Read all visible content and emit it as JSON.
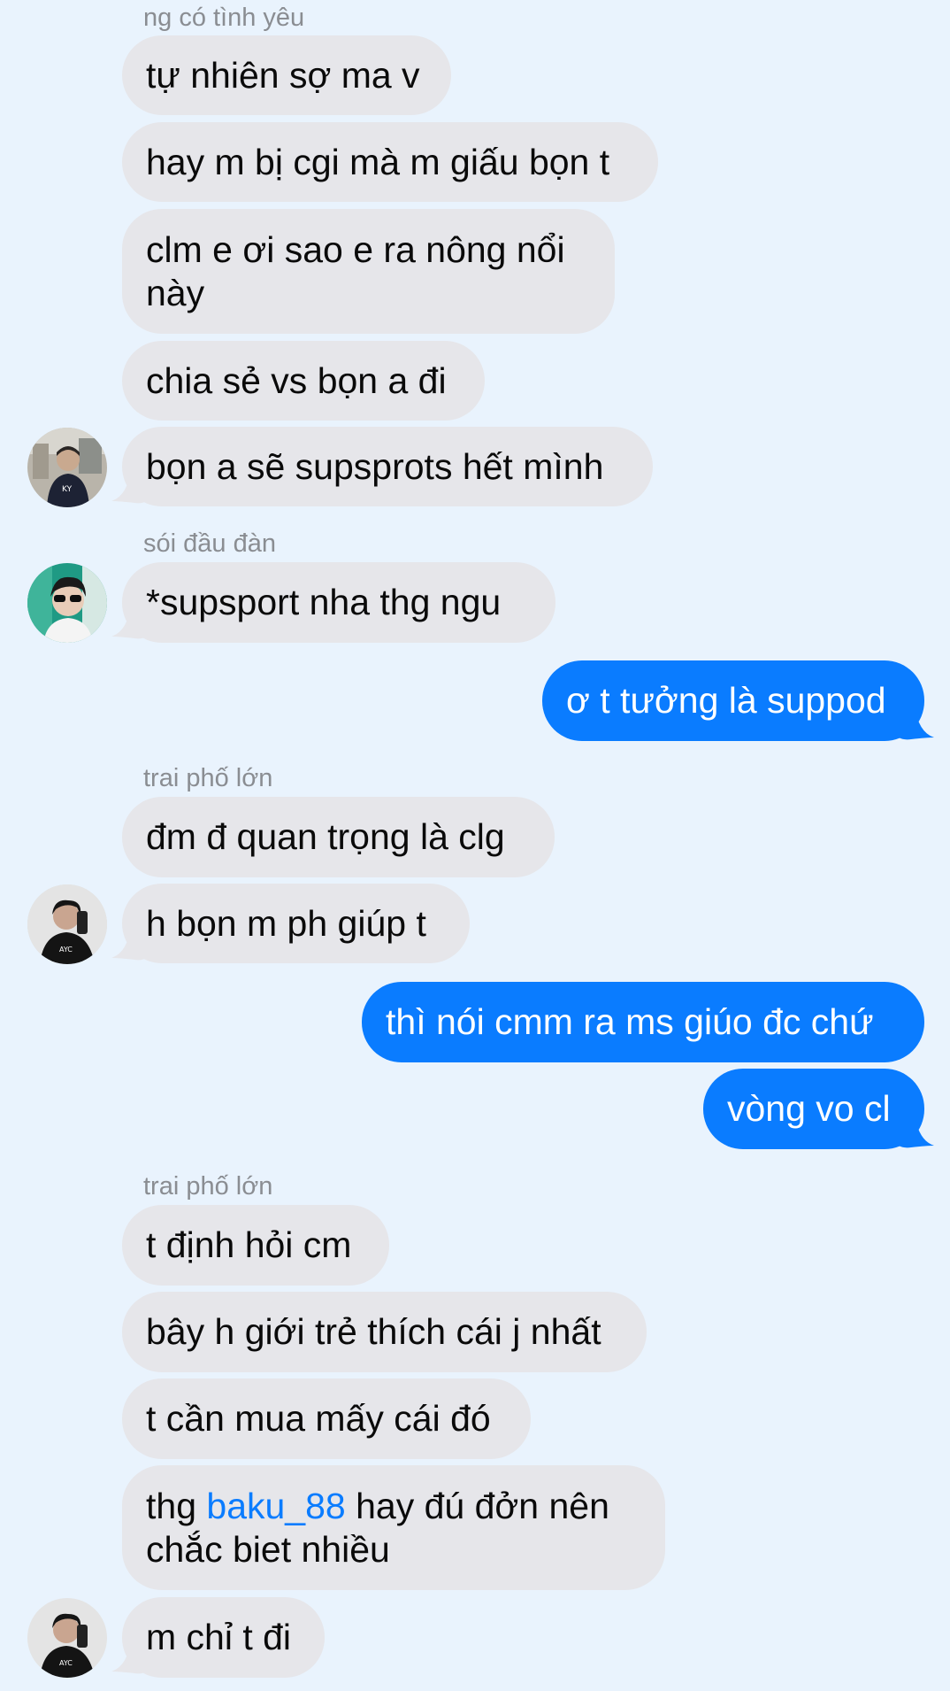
{
  "messages": [
    {
      "sender_name": "ng có tình yêu",
      "text": "tự nhiên sợ ma v"
    },
    {
      "text": "hay m bị cgi mà m giấu bọn t"
    },
    {
      "text_line1": "clm e ơi sao e ra nông nổi",
      "text_line2": "này"
    },
    {
      "text": "chia sẻ vs bọn a đi"
    },
    {
      "text": "bọn a sẽ supsprots hết mình"
    },
    {
      "sender_name": "sói đầu đàn",
      "text": "*supsport nha thg ngu"
    },
    {
      "text": "ơ t tưởng là suppod"
    },
    {
      "sender_name": "trai phố lớn",
      "text": "đm đ quan trọng là clg"
    },
    {
      "text": "h bọn m ph giúp t"
    },
    {
      "text": "thì nói cmm ra ms giúo đc chứ"
    },
    {
      "text": "vòng vo cl"
    },
    {
      "sender_name": "trai phố lớn",
      "text": "t định hỏi cm"
    },
    {
      "text": "bây h giới trẻ thích cái j nhất"
    },
    {
      "text": "t cần mua mấy cái đó"
    },
    {
      "text_prefix": "thg ",
      "mention": "baku_88",
      "text_suffix": " hay đú đởn nên",
      "text_line2": "chắc biet nhiều"
    },
    {
      "text": "m chỉ t đi"
    }
  ],
  "colors": {
    "background": "#e9f3fd",
    "incoming_bubble": "#e6e6ea",
    "outgoing_bubble": "#0a7cff",
    "mention": "#0a7cff",
    "sender_name": "#8a8d92"
  }
}
